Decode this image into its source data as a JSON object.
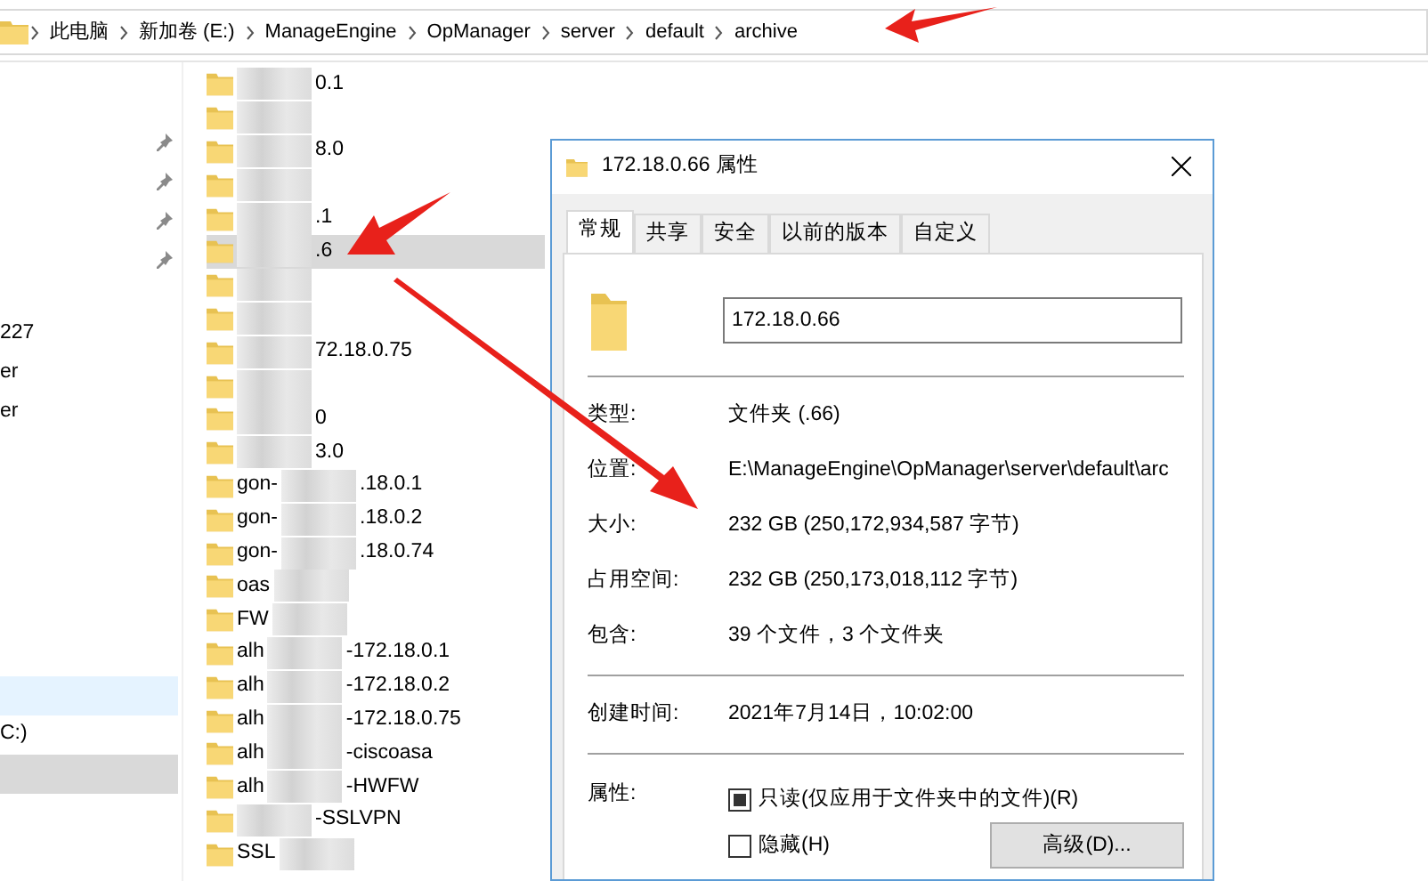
{
  "address_bar": {
    "crumbs": [
      "此电脑",
      "新加卷 (E:)",
      "ManageEngine",
      "OpManager",
      "server",
      "default",
      "archive"
    ]
  },
  "nav": {
    "sections": [
      {
        "items": [
          {
            "pinned": true,
            "selected": false,
            "hovered": false
          },
          {
            "pinned": true,
            "selected": false,
            "hovered": false
          },
          {
            "pinned": true,
            "selected": false,
            "hovered": false
          },
          {
            "pinned": true,
            "selected": false,
            "hovered": false
          }
        ]
      },
      {
        "items": [
          {
            "label": "227",
            "pinned": false,
            "selected": false,
            "hovered": false
          },
          {
            "label": "er",
            "pinned": false,
            "selected": false,
            "hovered": false
          },
          {
            "label": "er",
            "pinned": false,
            "selected": false,
            "hovered": false
          }
        ]
      },
      {
        "items": [
          {
            "pinned": false,
            "selected": false,
            "hovered": true
          },
          {
            "label": "C:)",
            "pinned": false,
            "selected": false,
            "hovered": false
          },
          {
            "pinned": false,
            "selected": true,
            "hovered": false
          }
        ]
      }
    ]
  },
  "files": [
    {
      "suffix": "0.1",
      "selected": false
    },
    {
      "selected": false
    },
    {
      "suffix": "8.0",
      "selected": false
    },
    {
      "selected": false
    },
    {
      "suffix": ".1",
      "selected": false
    },
    {
      "suffix": ".6",
      "selected": true
    },
    {
      "selected": false
    },
    {
      "selected": false
    },
    {
      "suffix": "72.18.0.75",
      "selected": false
    },
    {
      "selected": false
    },
    {
      "suffix": "0",
      "selected": false
    },
    {
      "suffix": "3.0",
      "selected": false
    },
    {
      "prefix": "gon-",
      "suffix": ".18.0.1",
      "selected": false
    },
    {
      "prefix": "gon-",
      "suffix": ".18.0.2",
      "selected": false
    },
    {
      "prefix": "gon-",
      "suffix": ".18.0.74",
      "selected": false
    },
    {
      "prefix": "oas",
      "selected": false
    },
    {
      "prefix": "FW",
      "selected": false
    },
    {
      "prefix": "alh",
      "suffix": "-172.18.0.1",
      "selected": false
    },
    {
      "prefix": "alh",
      "suffix": "-172.18.0.2",
      "selected": false
    },
    {
      "prefix": "alh",
      "suffix": "-172.18.0.75",
      "selected": false
    },
    {
      "prefix": "alh",
      "suffix": "-ciscoasa",
      "selected": false
    },
    {
      "prefix": "alh",
      "suffix": "-HWFW",
      "selected": false
    },
    {
      "suffix": "-SSLVPN",
      "selected": false
    },
    {
      "prefix": "SSL",
      "selected": false
    }
  ],
  "dialog": {
    "title": "172.18.0.66 属性",
    "tabs": [
      {
        "label": "常规",
        "selected": true
      },
      {
        "label": "共享",
        "selected": false
      },
      {
        "label": "安全",
        "selected": false
      },
      {
        "label": "以前的版本",
        "selected": false
      },
      {
        "label": "自定义",
        "selected": false
      }
    ],
    "name_value": "172.18.0.66",
    "groups": [
      [
        {
          "label": "类型:",
          "value": "文件夹 (.66)"
        },
        {
          "label": "位置:",
          "value": "E:\\ManageEngine\\OpManager\\server\\default\\arc"
        },
        {
          "label": "大小:",
          "value": "232 GB (250,172,934,587 字节)"
        },
        {
          "label": "占用空间:",
          "value": "232 GB (250,173,018,112 字节)"
        },
        {
          "label": "包含:",
          "value": "39 个文件，3 个文件夹"
        }
      ],
      [
        {
          "label": "创建时间:",
          "value": "2021年7月14日，10:02:00"
        }
      ]
    ],
    "attributes_label": "属性:",
    "checkboxes": [
      {
        "label": "只读(仅应用于文件夹中的文件)(R)",
        "checked": false,
        "indeterminate": true
      },
      {
        "label": "隐藏(H)",
        "checked": false,
        "indeterminate": false
      }
    ],
    "advanced_button": "高级(D)..."
  }
}
